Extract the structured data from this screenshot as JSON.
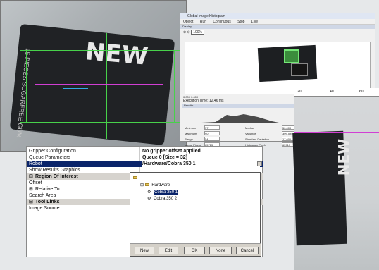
{
  "background_image": {
    "left_text": "NEW",
    "left_side_text": "15 PIECES SUGARFREE GUM",
    "right_text": "NEW"
  },
  "histogram_window": {
    "title": "Global Image Histogram",
    "menu": [
      "Object",
      "Run",
      "Continuous",
      "Stop",
      "Live"
    ],
    "section_display": "Display",
    "zoom_value": "100%",
    "coords": "0.000    0.000",
    "execution_time_label": "Execution Time:",
    "execution_time_value": "12.46 ms",
    "section_results": "Results",
    "stats": {
      "minimum_label": "Minimum",
      "minimum_value": "37",
      "maximum_label": "Maximum",
      "maximum_value": "90",
      "range_label": "Range",
      "range_value": "54",
      "image_pixels_label": "Image Pixels",
      "image_pixels_value": "65713",
      "median_label": "Median",
      "median_value": "50.000",
      "variance_label": "Variance",
      "variance_value": "309.595",
      "std_label": "Standard Deviation",
      "std_value": "17.601",
      "hist_pixels_label": "Histogram Pixels",
      "hist_pixels_value": "65713",
      "index_label": "Index"
    }
  },
  "right_ruler": [
    "20",
    "40",
    "60"
  ],
  "properties": {
    "rows": [
      {
        "key": "Gripper Configuration",
        "value": "No gripper offset applied"
      },
      {
        "key": "Queue Parameters",
        "value": "Queue 0 [Size = 32]"
      },
      {
        "key": "Robot",
        "value": "/Hardware/Cobra 350 1"
      },
      {
        "key": "Show Results Graphics",
        "value": ""
      },
      {
        "key": "Region Of Interest",
        "value": ""
      },
      {
        "key": "Offset",
        "value": ""
      },
      {
        "key": "Relative To",
        "value": ""
      },
      {
        "key": "Search Area",
        "value": ""
      },
      {
        "key": "Tool Links",
        "value": ""
      },
      {
        "key": "Image Source",
        "value": ""
      }
    ],
    "popup": {
      "tree": {
        "root": "Hardware",
        "children": [
          "Cobra 350 1",
          "Cobra 350 2"
        ]
      },
      "buttons": [
        "New",
        "Edit",
        "OK",
        "None",
        "Cancel"
      ]
    }
  }
}
